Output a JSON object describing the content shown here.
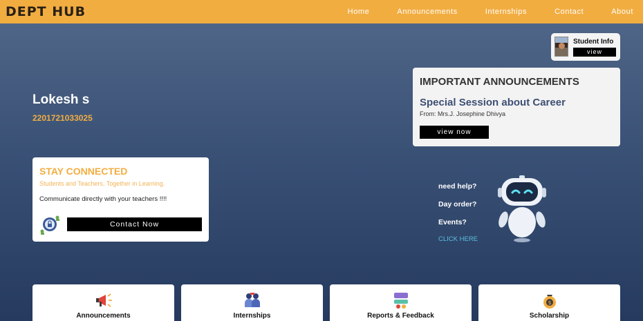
{
  "nav": {
    "brand": "DEPT HUB",
    "links": [
      "Home",
      "Announcements",
      "Internships",
      "Contact",
      "About"
    ]
  },
  "student_card": {
    "title": "Student Info",
    "view_label": "view"
  },
  "student": {
    "name": "Lokesh s",
    "id": "2201721033025"
  },
  "announcements": {
    "heading": "IMPORTANT ANNOUNCEMENTS",
    "title": "Special Session about Career",
    "from": "From: Mrs.J. Josephine Dhivya",
    "button": "view now"
  },
  "stay_connected": {
    "title": "STAY CONNECTED",
    "subtitle": "Students and Teachers, Together in Learning.",
    "text": "Communicate directly with your teachers !!!!",
    "button": "Contact Now"
  },
  "help": {
    "lines": [
      "need help?",
      "Day order?",
      "Events?"
    ],
    "cta": "CLICK HERE"
  },
  "tiles": [
    {
      "label": "Announcements",
      "icon": "megaphone-icon"
    },
    {
      "label": "Internships",
      "icon": "team-icon"
    },
    {
      "label": "Reports & Feedback",
      "icon": "report-icon"
    },
    {
      "label": "Scholarship",
      "icon": "money-bag-icon"
    }
  ],
  "colors": {
    "nav_bg": "#f2ad41",
    "accent": "#f2ad41",
    "link": "#5bc0de"
  }
}
